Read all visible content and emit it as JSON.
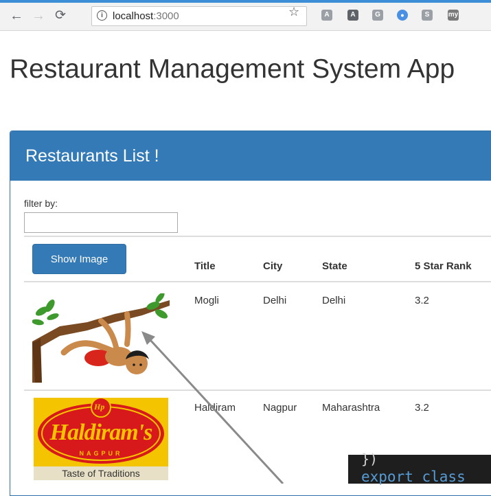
{
  "browser": {
    "url_host": "localhost",
    "url_port": ":3000",
    "extensions": [
      {
        "name": "angular-grey-icon",
        "glyph": "A",
        "color": "#9aa0a6"
      },
      {
        "name": "angular-dark-icon",
        "glyph": "A",
        "color": "#5f6368"
      },
      {
        "name": "google-ext-icon",
        "glyph": "G",
        "color": "#9aa0a6"
      },
      {
        "name": "record-ext-icon",
        "glyph": "•",
        "color": "#4a90e2"
      },
      {
        "name": "skype-ext-icon",
        "glyph": "S",
        "color": "#9aa0a6"
      },
      {
        "name": "my-ext-icon",
        "glyph": "my",
        "color": "#7a7a7a"
      }
    ]
  },
  "page": {
    "title": "Restaurant Management System App"
  },
  "panel": {
    "title": "Restaurants List !",
    "filter_label": "filter by:",
    "filter_value": "",
    "show_image_label": "Show Image",
    "columns": [
      "Title",
      "City",
      "State",
      "5 Star Rank"
    ],
    "rows": [
      {
        "title": "Mogli",
        "city": "Delhi",
        "state": "Delhi",
        "rank": "3.2",
        "image_alt": "mowgli-cartoon-image"
      },
      {
        "title": "Haldiram",
        "city": "Nagpur",
        "state": "Maharashtra",
        "rank": "3.2",
        "image_alt": "haldirams-logo-image",
        "logo_brand": "Haldiram's",
        "logo_city": "NAGPUR",
        "logo_tagline": "Taste of Traditions",
        "logo_badge": "Hp"
      }
    ]
  },
  "code": {
    "prev_line": "})",
    "line": "export class"
  },
  "colors": {
    "primary": "#337ab7",
    "logo_red": "#d7191c",
    "logo_yellow": "#f5c400"
  }
}
